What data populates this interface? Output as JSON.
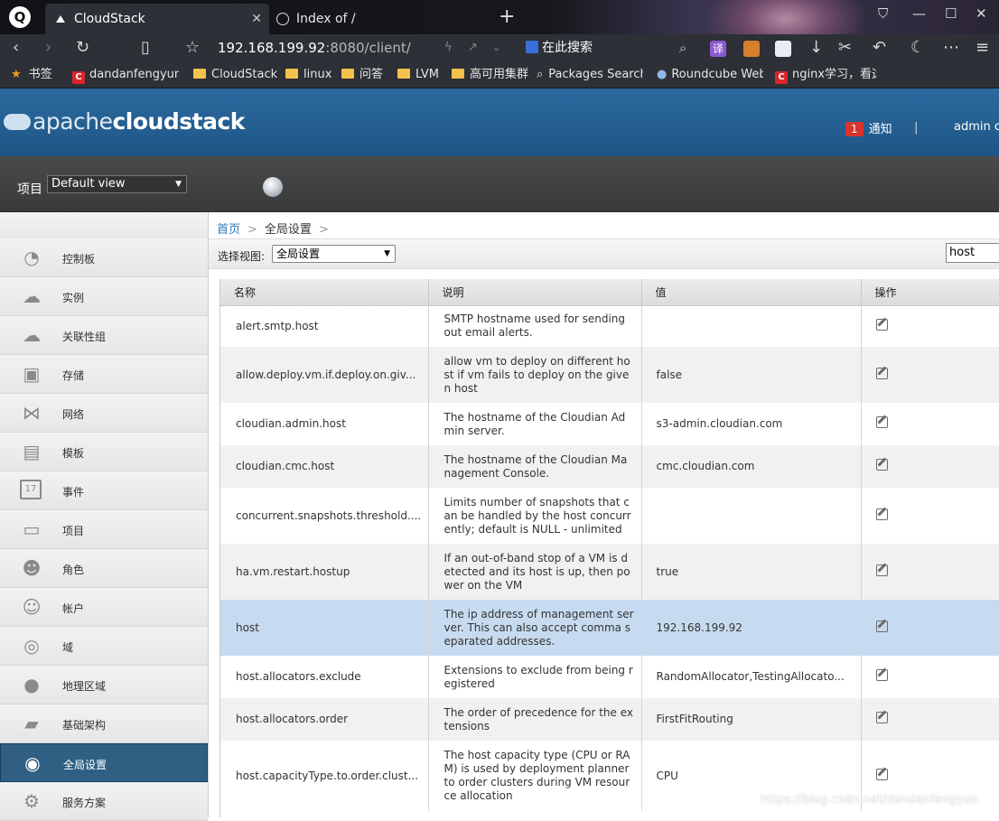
{
  "browser": {
    "tabs": [
      {
        "label": "CloudStack",
        "active": true
      },
      {
        "label": "Index of /",
        "active": false
      }
    ],
    "url_host": "192.168.199.92",
    "url_rest": ":8080/client/",
    "search_hint": "在此搜索",
    "bookmarks": [
      "书签",
      "dandanfengyun的",
      "CloudStack",
      "linux",
      "问答",
      "LVM",
      "高可用集群",
      "Packages Search",
      "Roundcube Web",
      "nginx学习，看这"
    ]
  },
  "header": {
    "logo_apache": "apache",
    "logo_cloudstack": "cloudstack",
    "notification_count": "1",
    "notification_label": "通知",
    "separator": "|",
    "user": "admin cl"
  },
  "project": {
    "label": "项目",
    "selected": "Default view"
  },
  "sidebar": {
    "items": [
      {
        "label": "控制板",
        "icon": "dashboard-icon"
      },
      {
        "label": "实例",
        "icon": "cloud-icon"
      },
      {
        "label": "关联性组",
        "icon": "affinity-cloud-icon"
      },
      {
        "label": "存储",
        "icon": "storage-icon"
      },
      {
        "label": "网络",
        "icon": "network-icon"
      },
      {
        "label": "模板",
        "icon": "template-icon"
      },
      {
        "label": "事件",
        "icon": "calendar-icon"
      },
      {
        "label": "项目",
        "icon": "folder-icon"
      },
      {
        "label": "角色",
        "icon": "roles-icon"
      },
      {
        "label": "帐户",
        "icon": "user-icon"
      },
      {
        "label": "域",
        "icon": "domain-icon"
      },
      {
        "label": "地理区域",
        "icon": "globe-icon"
      },
      {
        "label": "基础架构",
        "icon": "infrastructure-icon"
      },
      {
        "label": "全局设置",
        "icon": "global-settings-icon",
        "active": true
      },
      {
        "label": "服务方案",
        "icon": "gear-icon"
      }
    ],
    "calendar_day": "17"
  },
  "breadcrumb": {
    "home": "首页",
    "current": "全局设置",
    "sep": ">"
  },
  "toolbar": {
    "view_label": "选择视图:",
    "view_selected": "全局设置",
    "search_value": "host"
  },
  "table": {
    "headers": [
      "名称",
      "说明",
      "值",
      "操作"
    ],
    "rows": [
      {
        "name": "alert.smtp.host",
        "desc": "SMTP hostname used for sending out email alerts.",
        "value": ""
      },
      {
        "name": "allow.deploy.vm.if.deploy.on.giv...",
        "desc": "allow vm to deploy on different host if vm fails to deploy on the given host",
        "value": "false"
      },
      {
        "name": "cloudian.admin.host",
        "desc": "The hostname of the Cloudian Admin server.",
        "value": "s3-admin.cloudian.com"
      },
      {
        "name": "cloudian.cmc.host",
        "desc": "The hostname of the Cloudian Management Console.",
        "value": "cmc.cloudian.com"
      },
      {
        "name": "concurrent.snapshots.threshold....",
        "desc": "Limits number of snapshots that can be handled by the host concurrently; default is NULL - unlimited",
        "value": ""
      },
      {
        "name": "ha.vm.restart.hostup",
        "desc": "If an out-of-band stop of a VM is detected and its host is up, then power on the VM",
        "value": "true"
      },
      {
        "name": "host",
        "desc": "The ip address of management server. This can also accept comma separated addresses.",
        "value": "192.168.199.92"
      },
      {
        "name": "host.allocators.exclude",
        "desc": "Extensions to exclude from being registered",
        "value": "RandomAllocator,TestingAllocato..."
      },
      {
        "name": "host.allocators.order",
        "desc": "The order of precedence for the extensions",
        "value": "FirstFitRouting"
      },
      {
        "name": "host.capacityType.to.order.clust...",
        "desc": "The host capacity type (CPU or RAM) is used by deployment planner to order clusters during VM resource allocation",
        "value": "CPU"
      }
    ]
  },
  "watermark": "https://blog.csdn.net/dandanfengyun"
}
